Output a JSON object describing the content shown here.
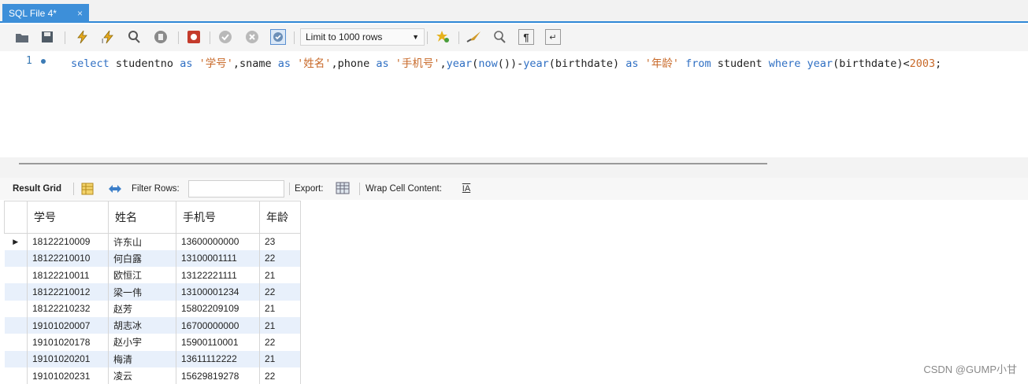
{
  "tab": {
    "title": "SQL File 4*",
    "close": "×"
  },
  "toolbar": {
    "limit_label": "Limit to 1000 rows"
  },
  "editor": {
    "line_number": "1",
    "code_tokens": [
      {
        "t": "select",
        "c": "kw"
      },
      {
        "t": " studentno ",
        "c": ""
      },
      {
        "t": "as",
        "c": "kw"
      },
      {
        "t": " ",
        "c": ""
      },
      {
        "t": "'学号'",
        "c": "str"
      },
      {
        "t": ",sname ",
        "c": ""
      },
      {
        "t": "as",
        "c": "kw"
      },
      {
        "t": " ",
        "c": ""
      },
      {
        "t": "'姓名'",
        "c": "str"
      },
      {
        "t": ",phone ",
        "c": ""
      },
      {
        "t": "as",
        "c": "kw"
      },
      {
        "t": " ",
        "c": ""
      },
      {
        "t": "'手机号'",
        "c": "str"
      },
      {
        "t": ",",
        "c": ""
      },
      {
        "t": "year",
        "c": "kw"
      },
      {
        "t": "(",
        "c": ""
      },
      {
        "t": "now",
        "c": "kw"
      },
      {
        "t": "())-",
        "c": ""
      },
      {
        "t": "year",
        "c": "kw"
      },
      {
        "t": "(birthdate) ",
        "c": ""
      },
      {
        "t": "as",
        "c": "kw"
      },
      {
        "t": " ",
        "c": ""
      },
      {
        "t": "'年龄'",
        "c": "str"
      },
      {
        "t": " ",
        "c": ""
      },
      {
        "t": "from",
        "c": "kw"
      },
      {
        "t": " student ",
        "c": ""
      },
      {
        "t": "where",
        "c": "kw"
      },
      {
        "t": " ",
        "c": ""
      },
      {
        "t": "year",
        "c": "kw"
      },
      {
        "t": "(birthdate)<",
        "c": ""
      },
      {
        "t": "2003",
        "c": "num"
      },
      {
        "t": ";",
        "c": ""
      }
    ]
  },
  "results_bar": {
    "result_grid": "Result Grid",
    "filter_rows": "Filter Rows:",
    "filter_value": "",
    "export": "Export:",
    "wrap": "Wrap Cell Content:"
  },
  "grid": {
    "columns": [
      "学号",
      "姓名",
      "手机号",
      "年龄"
    ],
    "rows": [
      [
        "18122210009",
        "许东山",
        "13600000000",
        "23"
      ],
      [
        "18122210010",
        "何白露",
        "13100001111",
        "22"
      ],
      [
        "18122210011",
        "欧恒江",
        "13122221111",
        "21"
      ],
      [
        "18122210012",
        "梁一伟",
        "13100001234",
        "22"
      ],
      [
        "18122210232",
        "赵芳",
        "15802209109",
        "21"
      ],
      [
        "19101020007",
        "胡志冰",
        "16700000000",
        "21"
      ],
      [
        "19101020178",
        "赵小宇",
        "15900110001",
        "22"
      ],
      [
        "19101020201",
        "梅清",
        "13611112222",
        "21"
      ],
      [
        "19101020231",
        "凌云",
        "15629819278",
        "22"
      ]
    ]
  },
  "watermark": "CSDN @GUMP小甘"
}
